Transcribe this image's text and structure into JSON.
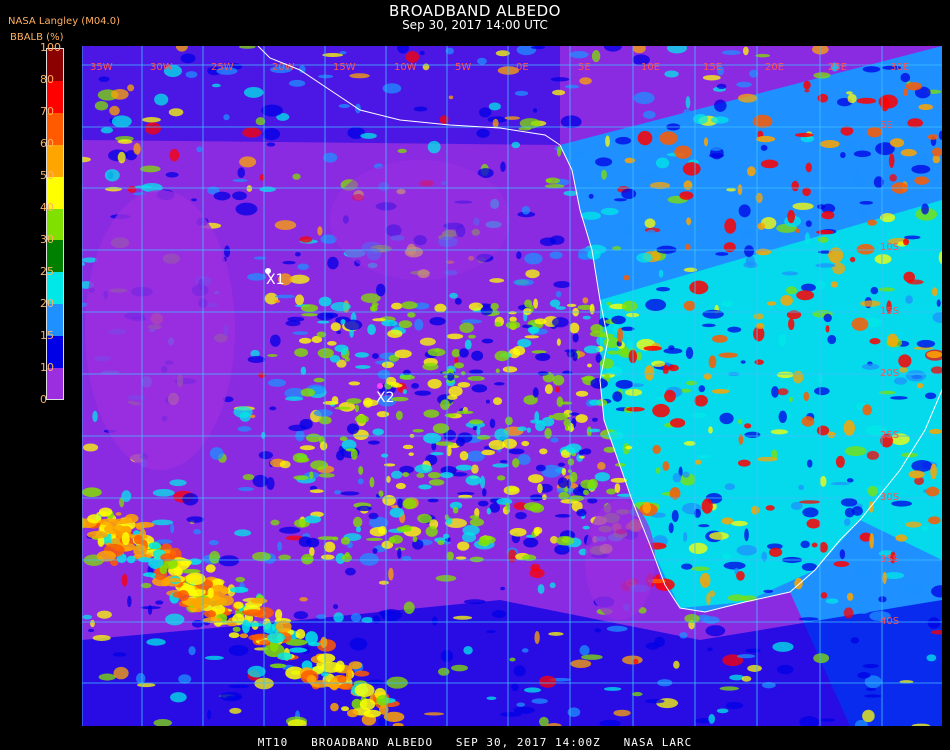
{
  "header": {
    "title": "BROADBAND ALBEDO",
    "subtitle": "Sep 30, 2017 14:00 UTC",
    "source": "NASA Langley (M04.0)",
    "units": "BBALB (%)"
  },
  "colorbar": {
    "ticks": [
      "100",
      "80",
      "70",
      "60",
      "50",
      "40",
      "30",
      "25",
      "20",
      "15",
      "10",
      "0"
    ],
    "bins": [
      {
        "color": "#9b2fe0"
      },
      {
        "color": "#0000e6"
      },
      {
        "color": "#1e90ff"
      },
      {
        "color": "#00e8e8"
      },
      {
        "color": "#008000"
      },
      {
        "color": "#80e000"
      },
      {
        "color": "#ffff00"
      },
      {
        "color": "#ffa500"
      },
      {
        "color": "#ff5a00"
      },
      {
        "color": "#ff0000"
      },
      {
        "color": "#8b0000"
      }
    ]
  },
  "grid": {
    "color": "#40c0ff",
    "lon_labels": [
      "35W",
      "30W",
      "25W",
      "20W",
      "15W",
      "10W",
      "5W",
      "0E",
      "5E",
      "10E",
      "15E",
      "20E",
      "25E",
      "30E"
    ],
    "lat_labels": [
      "5S",
      "10S",
      "15S",
      "20S",
      "25S",
      "30S",
      "35S",
      "40S"
    ]
  },
  "markers": [
    {
      "label": "X1",
      "color": "#ffffff"
    },
    {
      "label": "X2",
      "color": "#ff40ff"
    }
  ],
  "footer": "MT10   BROADBAND ALBEDO   SEP 30, 2017 14:00Z   NASA LARC"
}
